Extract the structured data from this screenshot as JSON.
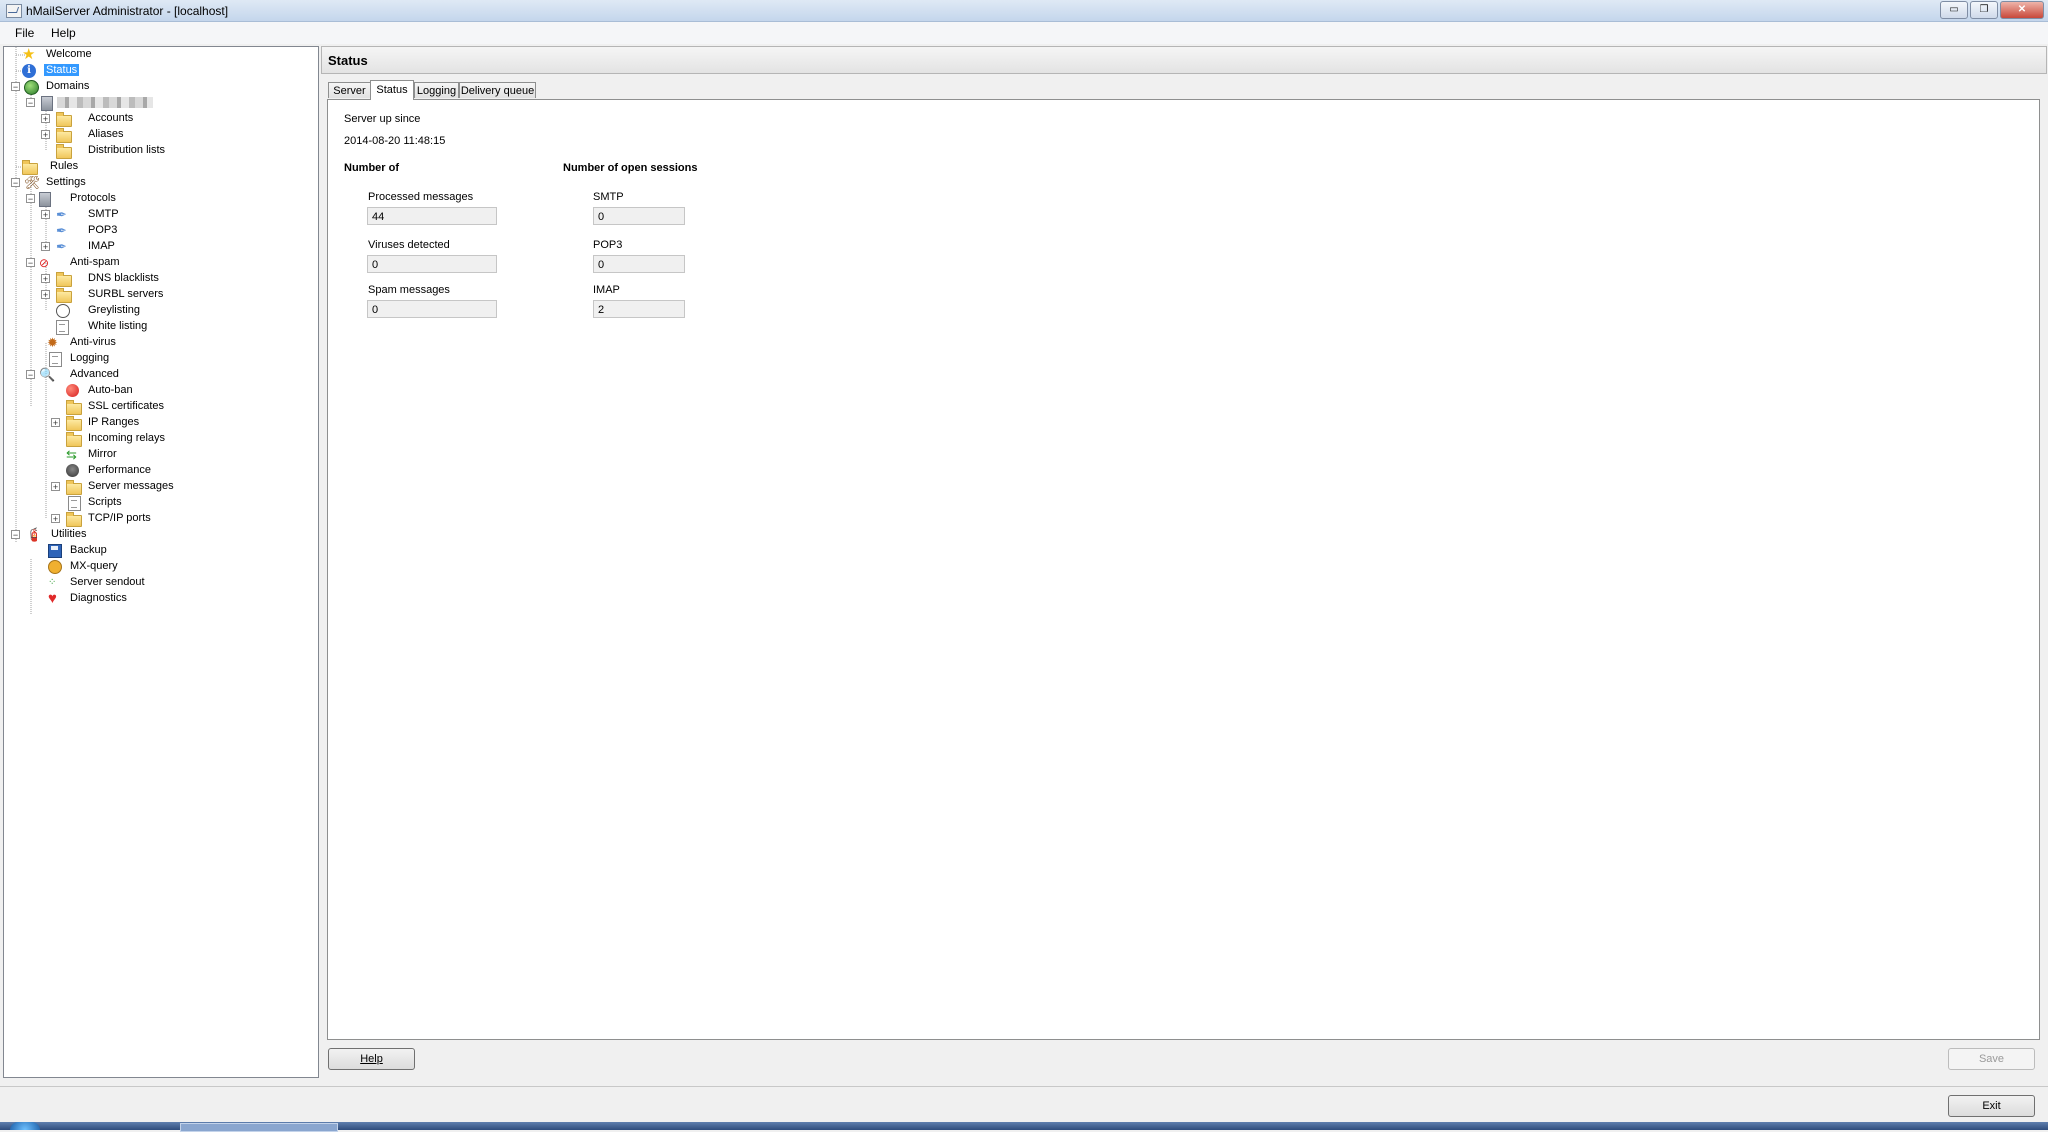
{
  "window": {
    "title": "hMailServer Administrator - [localhost]",
    "minimize": "▭",
    "restore": "❐",
    "close": "✕"
  },
  "menu": {
    "file": "File",
    "help": "Help"
  },
  "tree": {
    "welcome": "Welcome",
    "status": "Status",
    "domains": "Domains",
    "accounts": "Accounts",
    "aliases": "Aliases",
    "distribution_lists": "Distribution lists",
    "rules": "Rules",
    "settings": "Settings",
    "protocols": "Protocols",
    "smtp": "SMTP",
    "pop3": "POP3",
    "imap": "IMAP",
    "anti_spam": "Anti-spam",
    "dns_blacklists": "DNS blacklists",
    "surbl_servers": "SURBL servers",
    "greylisting": "Greylisting",
    "white_listing": "White listing",
    "anti_virus": "Anti-virus",
    "logging": "Logging",
    "advanced": "Advanced",
    "auto_ban": "Auto-ban",
    "ssl_certificates": "SSL certificates",
    "ip_ranges": "IP Ranges",
    "incoming_relays": "Incoming relays",
    "mirror": "Mirror",
    "performance": "Performance",
    "server_messages": "Server messages",
    "scripts": "Scripts",
    "tcpip_ports": "TCP/IP ports",
    "utilities": "Utilities",
    "backup": "Backup",
    "mx_query": "MX-query",
    "server_sendout": "Server sendout",
    "diagnostics": "Diagnostics"
  },
  "main": {
    "title": "Status",
    "tabs": [
      "Server",
      "Status",
      "Logging",
      "Delivery queue"
    ],
    "server_up_since_label": "Server up since",
    "server_up_since_value": "2014-08-20 11:48:15",
    "number_of_heading": "Number of",
    "open_sessions_heading": "Number of open sessions",
    "processed_label": "Processed messages",
    "processed_value": "44",
    "viruses_label": "Viruses detected",
    "viruses_value": "0",
    "spam_label": "Spam messages",
    "spam_value": "0",
    "smtp_label": "SMTP",
    "smtp_value": "0",
    "pop3_label": "POP3",
    "pop3_value": "0",
    "imap_label": "IMAP",
    "imap_value": "2"
  },
  "buttons": {
    "help": "Help",
    "save": "Save",
    "exit": "Exit"
  }
}
